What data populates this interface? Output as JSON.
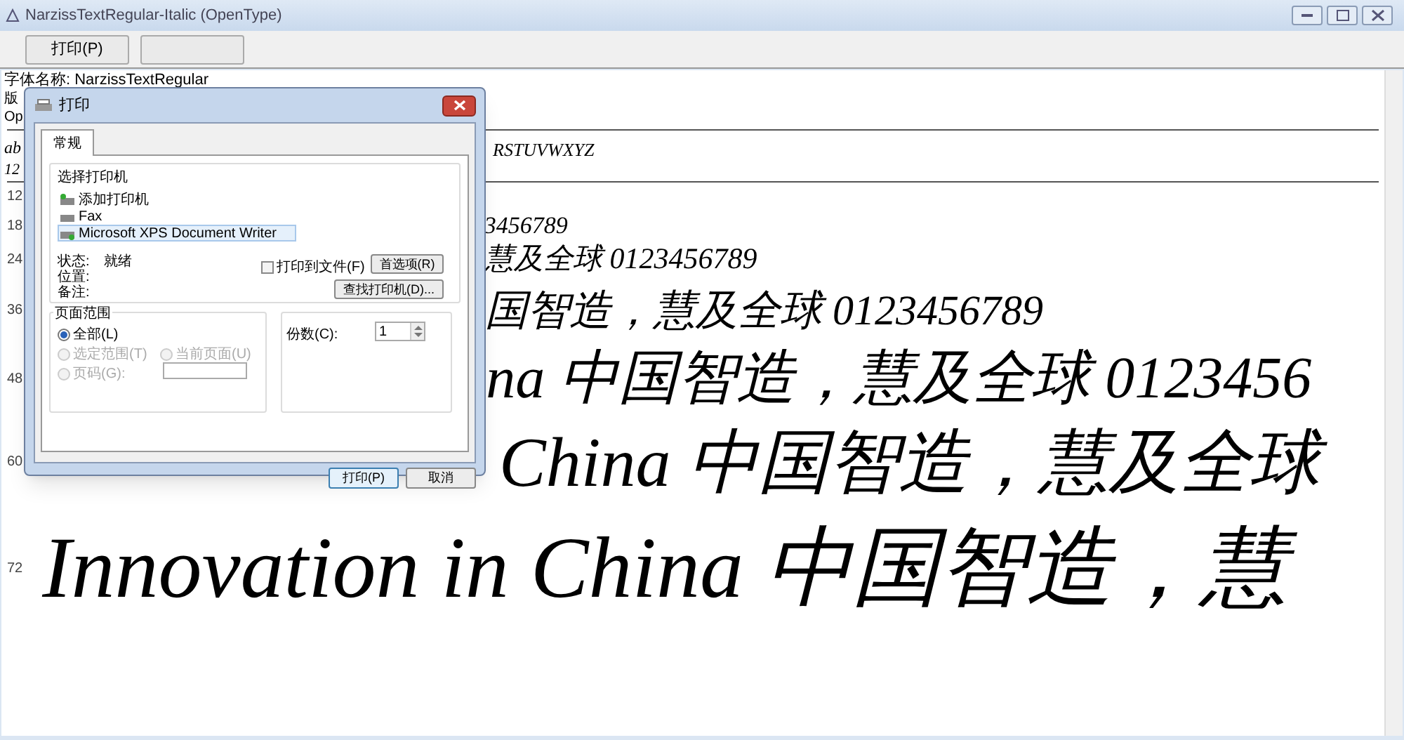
{
  "window": {
    "title": "NarzissTextRegular-Italic (OpenType)"
  },
  "toolbar": {
    "buttons": [
      "打印(P)"
    ]
  },
  "font_info": [
    "字体名称: NarzissTextRegular",
    "版",
    "Op"
  ],
  "alphabet_lines": [
    "ab",
    "RSTUVWXYZ",
    "12"
  ],
  "samples": [
    {
      "size": "12"
    },
    {
      "size": "18",
      "text": "3456789"
    },
    {
      "size": "24",
      "text": "慧及全球 0123456789"
    },
    {
      "size": "36",
      "text": "国智造，慧及全球 0123456789"
    },
    {
      "size": "48",
      "text": "na 中国智造，慧及全球 0123456"
    },
    {
      "size": "60",
      "text": "China 中国智造，慧及全球"
    },
    {
      "size": "72",
      "text": "Innovation in China 中国智造，慧"
    }
  ],
  "dialog": {
    "title": "打印",
    "tabs": [
      {
        "label": "常规",
        "selected": true
      }
    ],
    "printer_group": "选择打印机",
    "printers": [
      {
        "name": "添加打印机",
        "selected": false
      },
      {
        "name": "Fax",
        "selected": false
      },
      {
        "name": "Microsoft XPS Document Writer",
        "selected": true
      }
    ],
    "status_labels": [
      "状态:",
      "位置:",
      "备注:"
    ],
    "status_value": "就绪",
    "print_to_file": {
      "label": "打印到文件(F)",
      "checked": false
    },
    "preferences_button": "首选项(R)",
    "find_printer_button": "查找打印机(D)...",
    "range_group": "页面范围",
    "ranges": [
      {
        "label": "全部(L)",
        "selected": true,
        "disabled": false
      },
      {
        "label": "选定范围(T)",
        "selected": false,
        "disabled": true
      },
      {
        "label": "当前页面(U)",
        "selected": false,
        "disabled": true
      },
      {
        "label": "页码(G):",
        "selected": false,
        "disabled": true
      }
    ],
    "copies_label": "份数(C):",
    "copies": "1",
    "buttons": [
      "打印(P)",
      "取消"
    ]
  }
}
